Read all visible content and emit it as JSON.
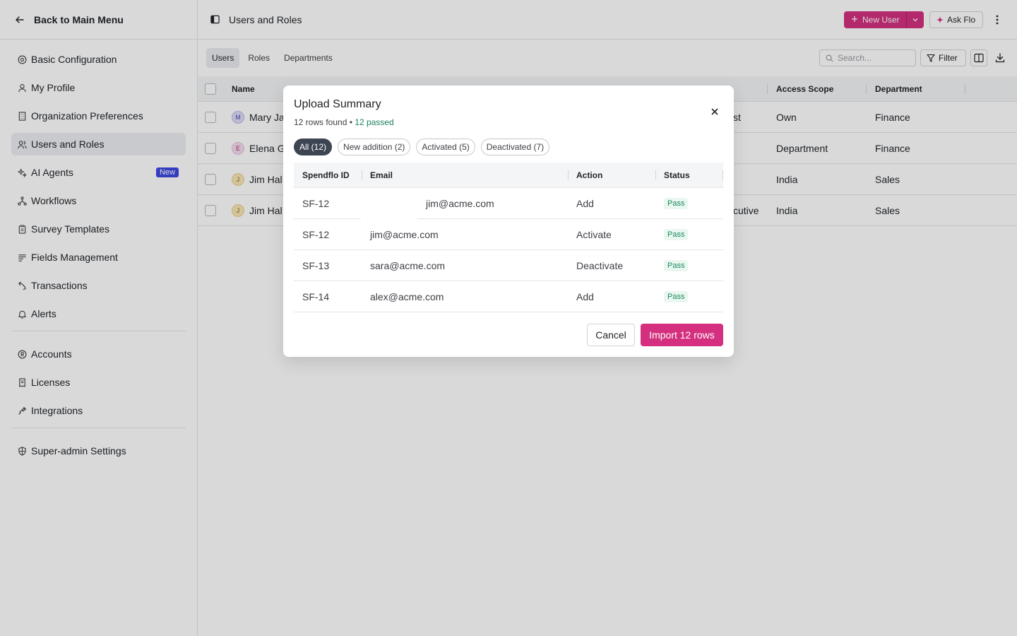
{
  "sidebar": {
    "back_label": "Back to Main Menu",
    "items": [
      {
        "label": "Basic Configuration"
      },
      {
        "label": "My Profile"
      },
      {
        "label": "Organization Preferences"
      },
      {
        "label": "Users and Roles"
      },
      {
        "label": "AI Agents",
        "badge": "New"
      },
      {
        "label": "Workflows"
      },
      {
        "label": "Survey Templates"
      },
      {
        "label": "Fields Management"
      },
      {
        "label": "Transactions"
      },
      {
        "label": "Alerts"
      }
    ],
    "items2": [
      {
        "label": "Accounts"
      },
      {
        "label": "Licenses"
      },
      {
        "label": "Integrations"
      }
    ],
    "items3": [
      {
        "label": "Super-admin Settings"
      }
    ],
    "active": "Users and Roles"
  },
  "header": {
    "title": "Users and Roles",
    "new_user_label": "New User",
    "ask_flo_label": "Ask Flo"
  },
  "toolbar": {
    "tabs": [
      {
        "label": "Users"
      },
      {
        "label": "Roles"
      },
      {
        "label": "Departments"
      }
    ],
    "search_placeholder": "Search...",
    "filter_label": "Filter"
  },
  "users_table": {
    "headers": {
      "name": "Name",
      "access_scope": "Access Scope",
      "department": "Department"
    },
    "rows": [
      {
        "initial": "M",
        "name": "Mary Ja",
        "role_fragment": "st",
        "access_scope": "Own",
        "department": "Finance"
      },
      {
        "initial": "E",
        "name": "Elena G",
        "role_fragment": "",
        "access_scope": "Department",
        "department": "Finance"
      },
      {
        "initial": "J",
        "name": "Jim Hal",
        "role_fragment": "",
        "access_scope": "India",
        "department": "Sales"
      },
      {
        "initial": "J",
        "name": "Jim Hal",
        "role_fragment": "cutive",
        "access_scope": "India",
        "department": "Sales"
      }
    ]
  },
  "modal": {
    "title": "Upload Summary",
    "rows_found": "12 rows found",
    "separator": "•",
    "passed": "12 passed",
    "chips": [
      {
        "label": "All (12)"
      },
      {
        "label": "New addition (2)"
      },
      {
        "label": "Activated (5)"
      },
      {
        "label": "Deactivated (7)"
      }
    ],
    "headers": {
      "id": "Spendflo ID",
      "email": "Email",
      "action": "Action",
      "status": "Status"
    },
    "rows": [
      {
        "id": "SF-12",
        "email": "jim@acme.com",
        "action": "Add",
        "status": "Pass"
      },
      {
        "id": "SF-12",
        "email": "jim@acme.com",
        "action": "Activate",
        "status": "Pass"
      },
      {
        "id": "SF-13",
        "email": "sara@acme.com",
        "action": "Deactivate",
        "status": "Pass"
      },
      {
        "id": "SF-14",
        "email": "alex@acme.com",
        "action": "Add",
        "status": "Pass"
      }
    ],
    "cancel_label": "Cancel",
    "import_label": "Import 12 rows"
  },
  "colors": {
    "accent": "#d4307f",
    "badge_blue": "#3b49df",
    "pass_green": "#1a8a5e"
  }
}
